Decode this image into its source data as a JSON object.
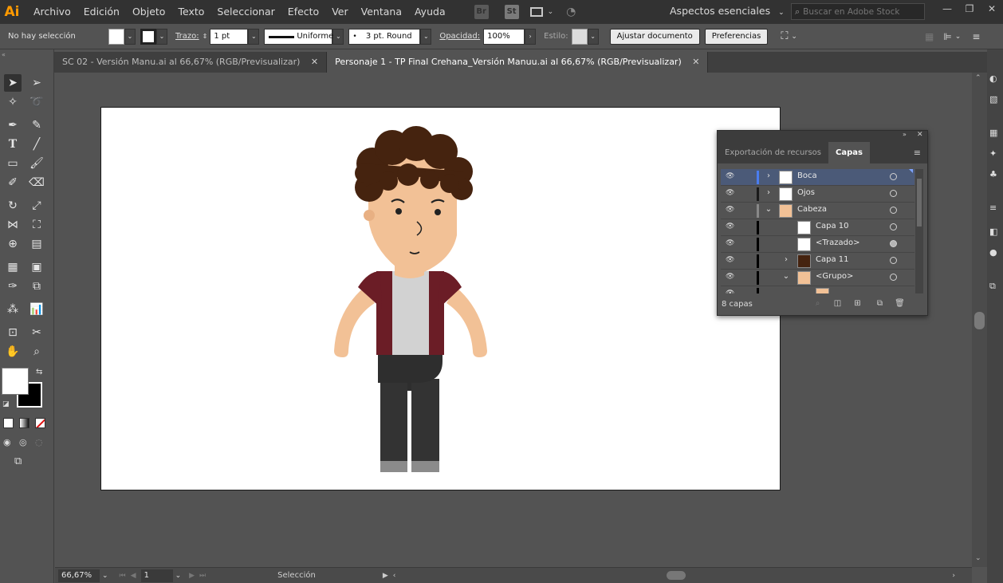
{
  "app": {
    "logo": "Ai"
  },
  "menu": [
    "Archivo",
    "Edición",
    "Objeto",
    "Texto",
    "Seleccionar",
    "Efecto",
    "Ver",
    "Ventana",
    "Ayuda"
  ],
  "app_buttons": [
    "Br",
    "St"
  ],
  "workspace": "Aspectos esenciales",
  "stock_search": {
    "placeholder": "Buscar en Adobe Stock"
  },
  "control": {
    "selection": "No hay selección",
    "stroke_label": "Trazo:",
    "stroke_weight": "1 pt",
    "profile": "Uniforme",
    "brush": "3 pt. Round",
    "opacity_label": "Opacidad:",
    "opacity_value": "100%",
    "style_label": "Estilo:",
    "adjust_button": "Ajustar documento",
    "prefs_button": "Preferencias"
  },
  "tabs": [
    {
      "label": "SC 02 - Versión Manu.ai al 66,67% (RGB/Previsualizar)",
      "active": false
    },
    {
      "label": "Personaje 1 - TP Final Crehana_Versión Manuu.ai al 66,67% (RGB/Previsualizar)",
      "active": true
    }
  ],
  "layers_panel": {
    "tabs": [
      "Exportación de recursos",
      "Capas"
    ],
    "active_tab": "Capas",
    "count_label": "8 capas",
    "layers": [
      {
        "name": "Boca",
        "selected": true,
        "expand": "›",
        "color": "#4a7df0"
      },
      {
        "name": "Ojos",
        "selected": false,
        "expand": "›",
        "color": "#1a1a1a"
      },
      {
        "name": "Cabeza",
        "selected": false,
        "expand": "⌄",
        "color": "#888888"
      },
      {
        "name": "Capa 10",
        "selected": false,
        "expand": "",
        "color": "#000000"
      },
      {
        "name": "<Trazado>",
        "selected": false,
        "expand": "",
        "color": "#000000"
      },
      {
        "name": "Capa 11",
        "selected": false,
        "expand": "›",
        "color": "#000000"
      },
      {
        "name": "<Grupo>",
        "selected": false,
        "expand": "⌄",
        "color": "#000000"
      }
    ]
  },
  "status": {
    "zoom": "66,67%",
    "page": "1",
    "tool": "Selección"
  },
  "colors": {
    "skin": "#f2c196",
    "hair": "#45230f",
    "shirt": "#6b1d26",
    "tshirt": "#d2d2d2",
    "pants": "#333333",
    "shoes": "#8b8b8b"
  }
}
